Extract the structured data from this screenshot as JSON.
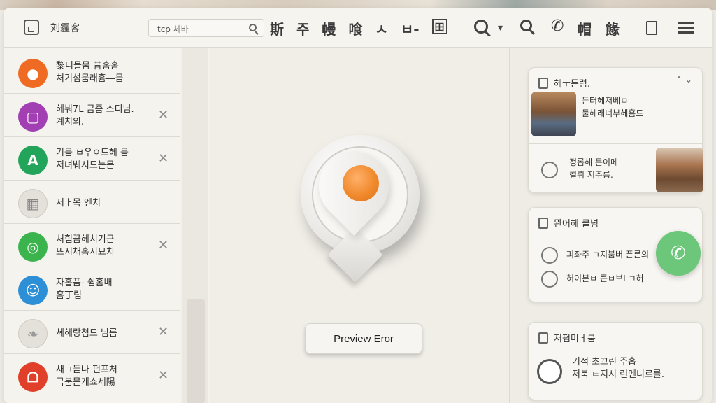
{
  "toolbar": {
    "app_title": "刘霾客",
    "search_text": "tcp 체바",
    "menu": [
      "斯",
      "주",
      "幔",
      "喰",
      "ㅅ",
      "ㅂ-"
    ],
    "icon_box_label": "田",
    "word1": "帽",
    "word2": "餯"
  },
  "list": [
    {
      "line1": "黎니믈뭄 昔홈홈",
      "line2": "처기섬뭄래흄―믐",
      "color": "#ef6a22",
      "icon": "person-icon",
      "closable": false
    },
    {
      "line1": "헤붜7L 금좀 스디님.",
      "line2": "계치의.",
      "color": "#a23fb3",
      "icon": "window-icon",
      "closable": true
    },
    {
      "line1": "기믐 ㅂ우ㅇ드헤 믐",
      "line2": "저녀붸시드는믄",
      "color": "#22a55a",
      "icon": "letter-a-icon",
      "closable": true
    },
    {
      "line1": "저ㅏ목 엔치",
      "line2": "",
      "color": "#d8d5cf",
      "icon": "store-icon",
      "closable": false
    },
    {
      "line1": "처힘끔헤치기근",
      "line2": "뜨시채홈시묘치",
      "color": "#3bb44e",
      "icon": "chat-bubble-icon",
      "closable": true
    },
    {
      "line1": "자홉픔- 쉼홈배",
      "line2": "홈丁림",
      "color": "#2d8fd6",
      "icon": "message-icon",
      "closable": false
    },
    {
      "line1": "쳬헤랑첨드 님름",
      "line2": "",
      "color": "#d8d5cf",
      "icon": "leaf-icon",
      "closable": true
    },
    {
      "line1": "새ㄱ듣나 펀프처",
      "line2": "극붐믇게쇼세陽",
      "color": "#e0402a",
      "icon": "person-outline-icon",
      "closable": true
    }
  ],
  "preview": {
    "button_label": "Preview Eror"
  },
  "cards": [
    {
      "title": "헤ㅜ든럼.",
      "text1": "든터헤저베ㅁ",
      "text1b": "둘헤래녀부헤흠드",
      "text2": "정롭헤 든이메",
      "text2b": "켤뤼 저주름."
    },
    {
      "title": "뫈어헤 클넘",
      "row1": "피좌주 ㄱ지붐버 픈른의",
      "row2": "허이븐ㅂ 큰ㅂ브I ㄱ허"
    },
    {
      "title": "저펌미ㅓ붐",
      "text1": "기적 초끄린  주홉",
      "text1b": "저북  ㅌ지시 런멘니르를."
    }
  ]
}
